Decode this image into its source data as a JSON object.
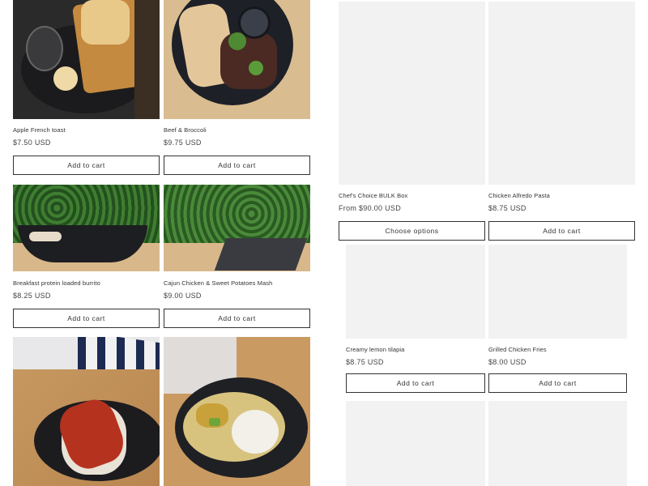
{
  "left_grid": [
    {
      "title": "Apple French toast",
      "price": "$7.50 USD",
      "button": "Add to cart"
    },
    {
      "title": "Beef & Broccoli",
      "price": "$9.75 USD",
      "button": "Add to cart"
    },
    {
      "title": "Breakfast protein loaded burrito",
      "price": "$8.25 USD",
      "button": "Add to cart"
    },
    {
      "title": "Cajun Chicken & Sweet Potatoes Mash",
      "price": "$9.00 USD",
      "button": "Add to cart"
    }
  ],
  "right_grid": [
    {
      "title": "Chef's Choice BULK Box",
      "price": "From $90.00 USD",
      "button": "Choose options"
    },
    {
      "title": "Chicken Alfredo Pasta",
      "price": "$8.75 USD",
      "button": "Add to cart"
    },
    {
      "title": "Creamy lemon tilapia",
      "price": "$8.75 USD",
      "button": "Add to cart"
    },
    {
      "title": "Grilled Chicken Fries",
      "price": "$8.00 USD",
      "button": "Add to cart"
    }
  ],
  "colors": {
    "button_border": "#333333",
    "placeholder": "#f2f2f2",
    "wood": "#d8b88a",
    "plate": "#1e1f22",
    "hedge": "#2f6a2a"
  }
}
